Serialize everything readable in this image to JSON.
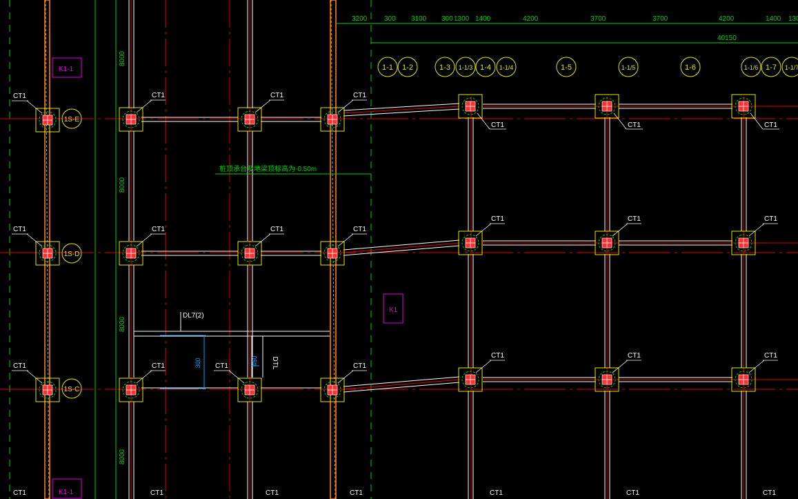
{
  "colors": {
    "background": "#000000",
    "grid_red": "#e00000",
    "beam_white": "#ffffff",
    "pile_yellow": "#e8e800",
    "pile_red": "#ff3030",
    "dim_green": "#00d000",
    "axis_yellow": "#e6e600",
    "magenta": "#e000e0",
    "cyan": "#00a0ff",
    "orange": "#ff8c1a"
  },
  "dimensions_top": [
    "3200",
    "300",
    "3100",
    "300",
    "1300",
    "1400",
    "4200",
    "3700",
    "3700",
    "4200",
    "1400",
    "130"
  ],
  "dimension_total": "40150",
  "axis_bubbles": [
    "1-1",
    "1-2",
    "1-3",
    "1-1/3",
    "1-4",
    "1-1/4",
    "1-5",
    "1-1/5",
    "1-6",
    "1-1/6",
    "1-7",
    "1-1/7"
  ],
  "row_bubbles": [
    "1S-E",
    "1S-D",
    "1S-C"
  ],
  "vertical_dims": [
    "8000",
    "8000",
    "8000",
    "8000"
  ],
  "pile_label": "CT1",
  "section_marks": [
    "K1-1",
    "K1",
    "K1-1"
  ],
  "note_text": "桩顶承台及地梁顶标高为-0.50m",
  "beam_label": "DL7(2)",
  "dim_300": "300",
  "dim_450": "450",
  "dtl_label": "DTL"
}
